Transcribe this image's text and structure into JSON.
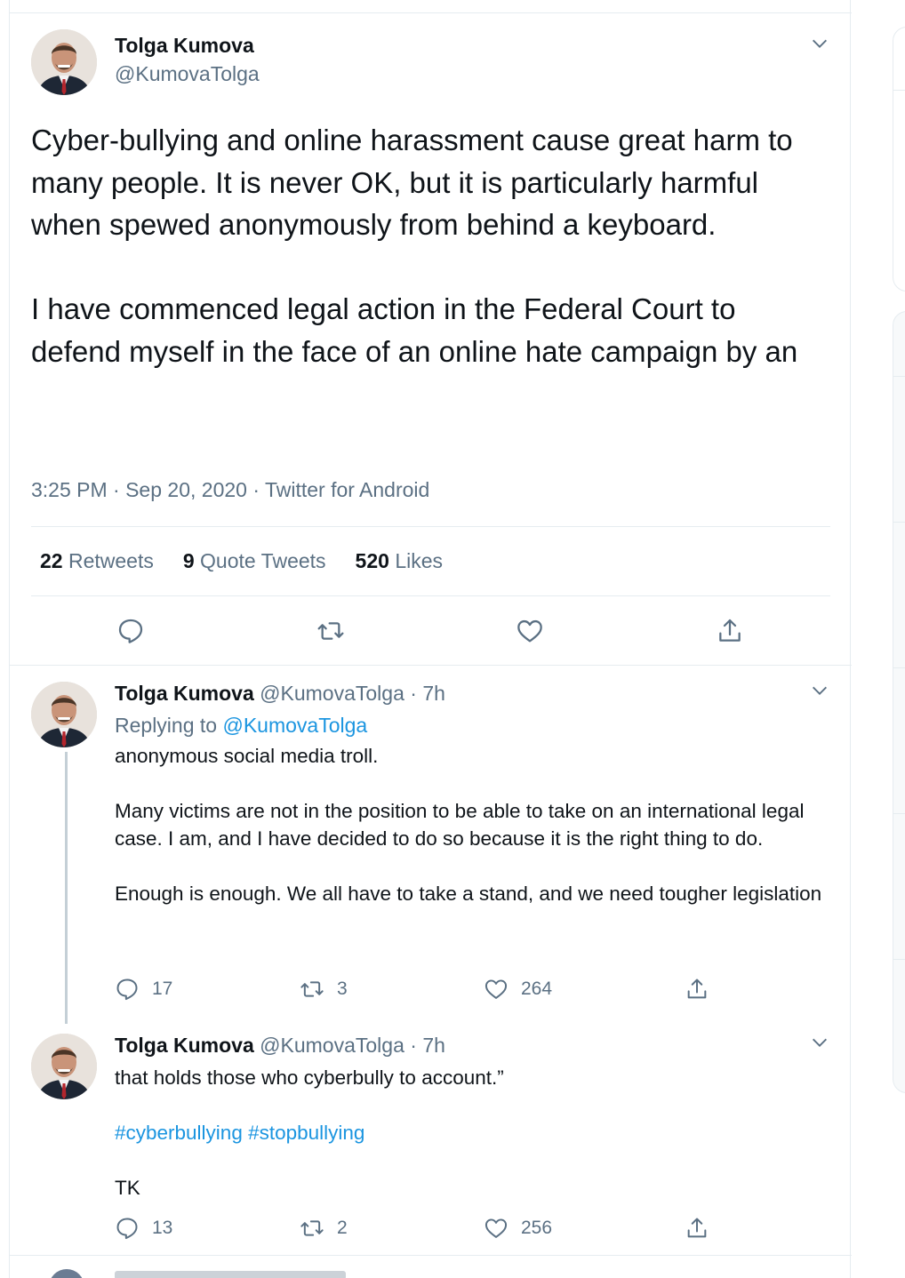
{
  "main_tweet": {
    "name": "Tolga Kumova",
    "handle": "@KumovaTolga",
    "text": "Cyber-bullying and online harassment cause great harm to many people. It is never OK, but it is particularly harmful when spewed anonymously from behind a keyboard.\n\nI have commenced legal action in the Federal Court to defend myself in the face of an online hate campaign by an",
    "meta": "3:25 PM · Sep 20, 2020 · Twitter for Android",
    "retweets_count": "22",
    "retweets_label": "Retweets",
    "quotes_count": "9",
    "quotes_label": "Quote Tweets",
    "likes_count": "520",
    "likes_label": "Likes",
    "icons": [
      "reply-icon",
      "retweet-icon",
      "like-icon",
      "share-icon"
    ]
  },
  "replies": [
    {
      "name": "Tolga Kumova",
      "handle": "@KumovaTolga",
      "time": "· 7h",
      "replying_prefix": "Replying to",
      "replying_to": "@KumovaTolga",
      "text": "anonymous social media troll.\n\nMany victims are not in the position to be able to take on an international legal case. I am, and I have decided to do so because it is the right thing to do.\n\nEnough is enough. We all have to take a stand, and we need tougher legislation",
      "reply_count": "17",
      "retweet_count": "3",
      "like_count": "264"
    },
    {
      "name": "Tolga Kumova",
      "handle": "@KumovaTolga",
      "time": "· 7h",
      "text_line1": "that holds those who cyberbully to account.”",
      "hashtags": "#cyberbullying #stopbullying",
      "signoff": "TK",
      "reply_count": "13",
      "retweet_count": "2",
      "like_count": "256"
    }
  ],
  "colors": {
    "link": "#1b95e0",
    "muted": "#5b7083",
    "divider": "#e6ecf0"
  }
}
